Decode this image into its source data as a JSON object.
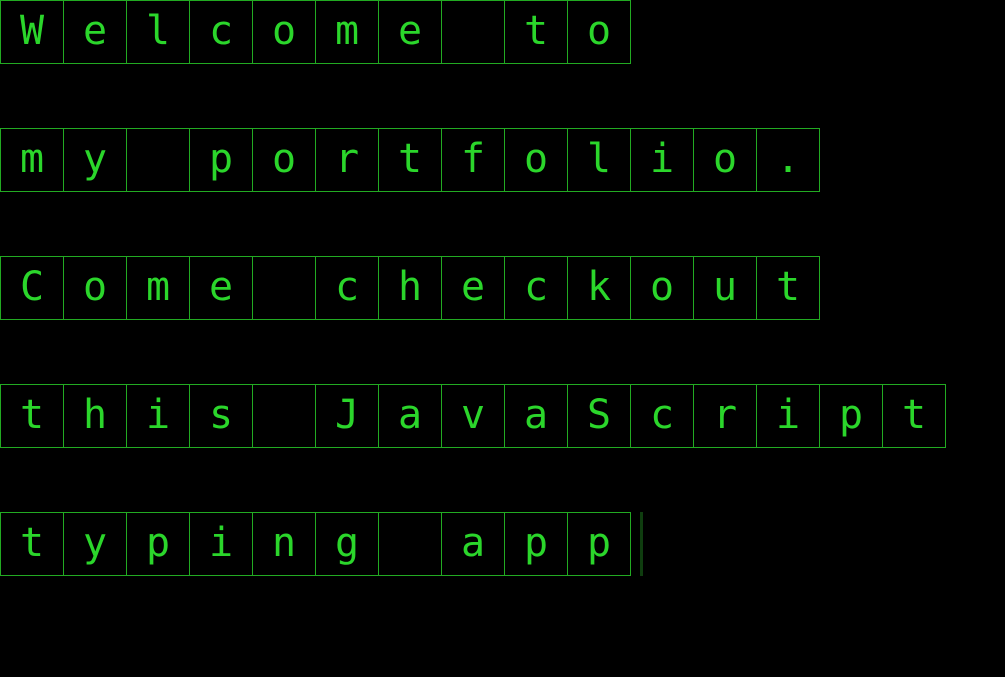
{
  "typing_app": {
    "lines": [
      "Welcome to",
      "my portfolio.",
      "Come checkout",
      "this JavaScript",
      "typing app"
    ],
    "colors": {
      "background": "#000000",
      "text": "#2bd62b",
      "cell_border": "#22aa22",
      "cursor": "#0f3d0f"
    },
    "cursor_visible": true
  }
}
